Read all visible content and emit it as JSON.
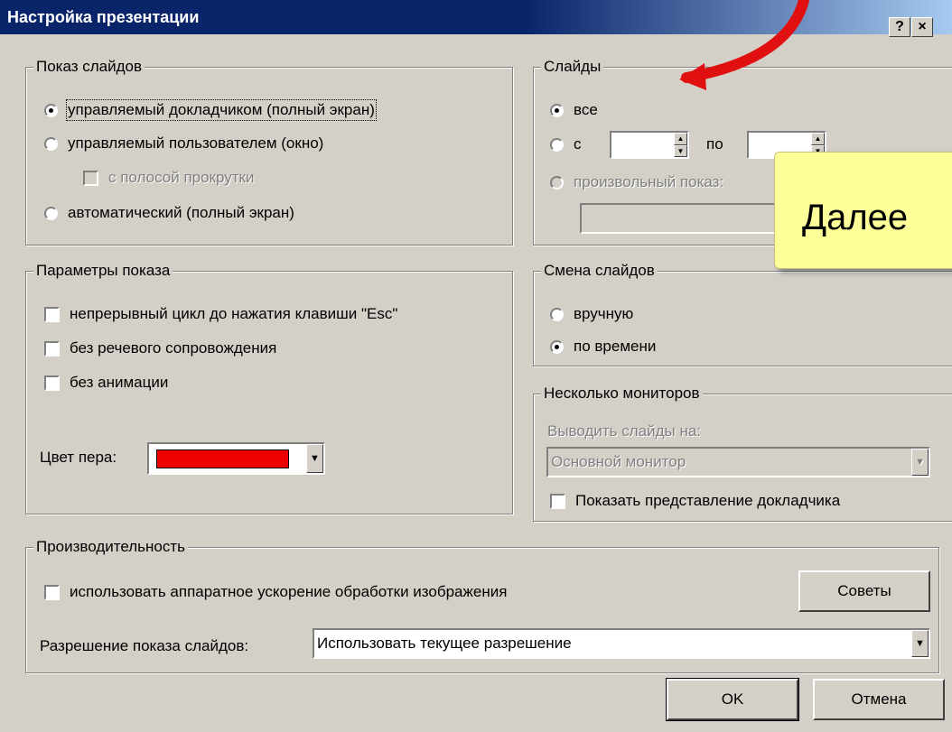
{
  "window": {
    "title": "Настройка презентации",
    "help_btn": "?",
    "close_btn": "×"
  },
  "show": {
    "label": "Показ слайдов",
    "presenter": "управляемый докладчиком (полный экран)",
    "user": "управляемый пользователем (окно)",
    "scrollbar": "с полосой прокрутки",
    "kiosk": "автоматический (полный экран)"
  },
  "slides": {
    "label": "Слайды",
    "all": "все",
    "from": "с",
    "to": "по",
    "custom": "произвольный показ:"
  },
  "options": {
    "label": "Параметры показа",
    "loop": "непрерывный цикл до нажатия клавиши \"Esc\"",
    "no_narration": "без речевого сопровождения",
    "no_animation": "без анимации",
    "pen_color_label": "Цвет пера:",
    "pen_color": "#ee0000"
  },
  "advance": {
    "label": "Смена слайдов",
    "manual": "вручную",
    "timings": "по времени"
  },
  "monitors": {
    "label": "Несколько мониторов",
    "display_on": "Выводить слайды на:",
    "monitor_value": "Основной монитор",
    "presenter_view": "Показать представление докладчика"
  },
  "performance": {
    "label": "Производительность",
    "hw_accel": "использовать аппаратное ускорение обработки изображения",
    "tips": "Советы",
    "resolution_label": "Разрешение показа слайдов:",
    "resolution_value": "Использовать текущее разрешение"
  },
  "buttons": {
    "ok": "OK",
    "cancel": "Отмена"
  },
  "callout": {
    "text": "Далее"
  },
  "colors": {
    "title_bar": "#0a246a",
    "dialog": "#d4d0c8",
    "callout": "#ffff99",
    "arrow": "#e01010"
  }
}
